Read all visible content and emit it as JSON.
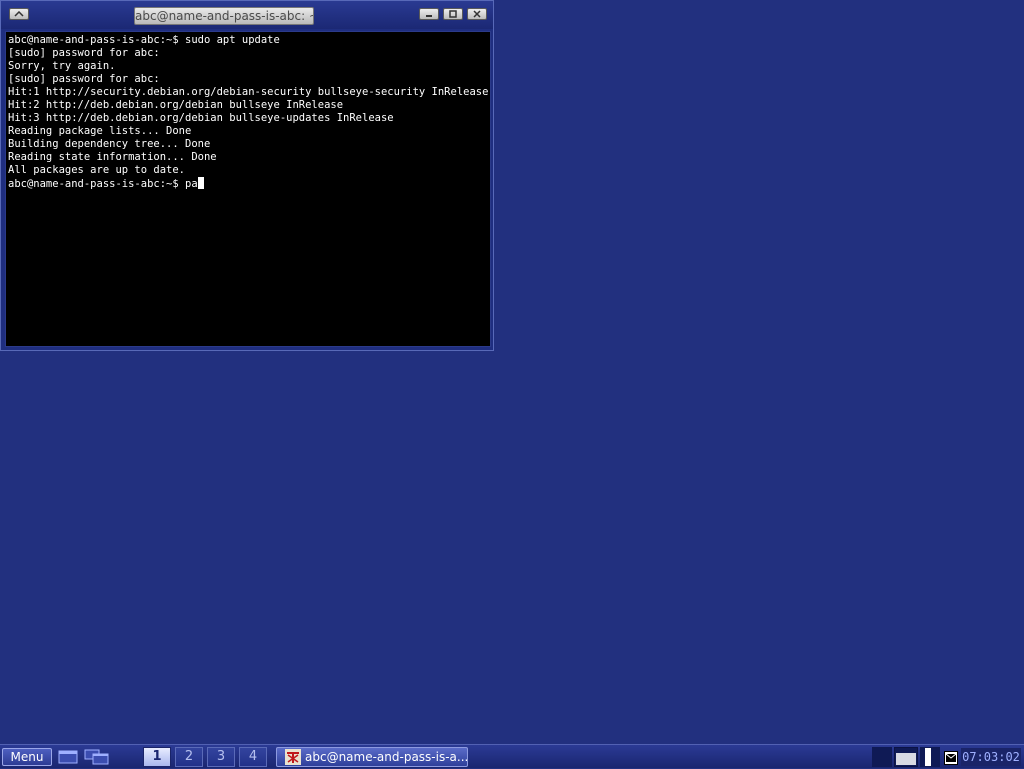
{
  "window": {
    "title": "abc@name-and-pass-is-abc: ~"
  },
  "terminal": {
    "lines": [
      "abc@name-and-pass-is-abc:~$ sudo apt update",
      "[sudo] password for abc:",
      "Sorry, try again.",
      "[sudo] password for abc:",
      "Hit:1 http://security.debian.org/debian-security bullseye-security InRelease",
      "Hit:2 http://deb.debian.org/debian bullseye InRelease",
      "Hit:3 http://deb.debian.org/debian bullseye-updates InRelease",
      "Reading package lists... Done",
      "Building dependency tree... Done",
      "Reading state information... Done",
      "All packages are up to date.",
      "abc@name-and-pass-is-abc:~$ pa"
    ]
  },
  "taskbar": {
    "menu_label": "Menu",
    "desktops": [
      "1",
      "2",
      "3",
      "4"
    ],
    "active_desktop": "1",
    "task_label": "abc@name-and-pass-is-a...",
    "clock": "07:03:02"
  },
  "colors": {
    "desktop_bg": "#22307f",
    "terminal_bg": "#000000",
    "terminal_fg": "#ffffff"
  },
  "icons": {
    "window_menu": "window-menu-icon",
    "minimize": "minimize-icon",
    "maximize": "maximize-icon",
    "close": "close-icon",
    "show_desktop": "show-desktop-icon",
    "window_list": "window-list-icon",
    "terminal_app": "terminal-app-icon",
    "mail": "mail-icon"
  }
}
